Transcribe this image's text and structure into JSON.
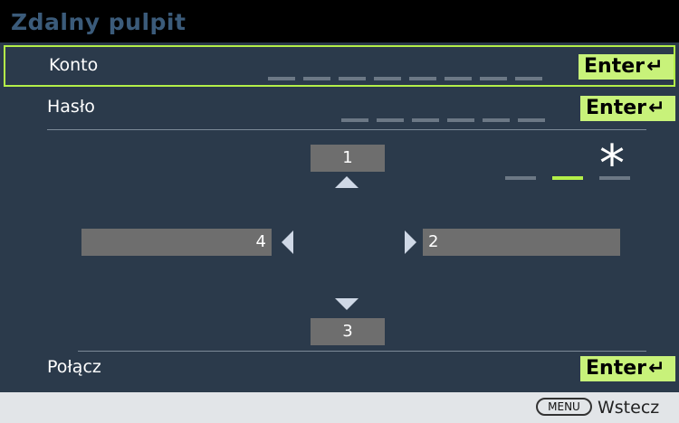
{
  "window": {
    "title": "Zdalny pulpit"
  },
  "rows": [
    {
      "label": "Konto",
      "button": "Enter"
    },
    {
      "label": "Hasło",
      "button": "Enter"
    },
    {
      "label": "Połącz",
      "button": "Enter"
    }
  ],
  "keypad": {
    "up": "1",
    "right": "2",
    "down": "3",
    "left": "4",
    "mask_char": "*"
  },
  "footer": {
    "menu_key": "MENU",
    "back_label": "Wstecz"
  },
  "colors": {
    "accent": "#b4ef49",
    "button_bg": "#c8f27a",
    "panel_bg": "#2b3a4b",
    "field_bg": "#6e6e6e"
  },
  "icons": [
    "enter-icon",
    "arrow-up-icon",
    "arrow-down-icon",
    "arrow-left-icon",
    "arrow-right-icon",
    "asterisk-icon"
  ]
}
